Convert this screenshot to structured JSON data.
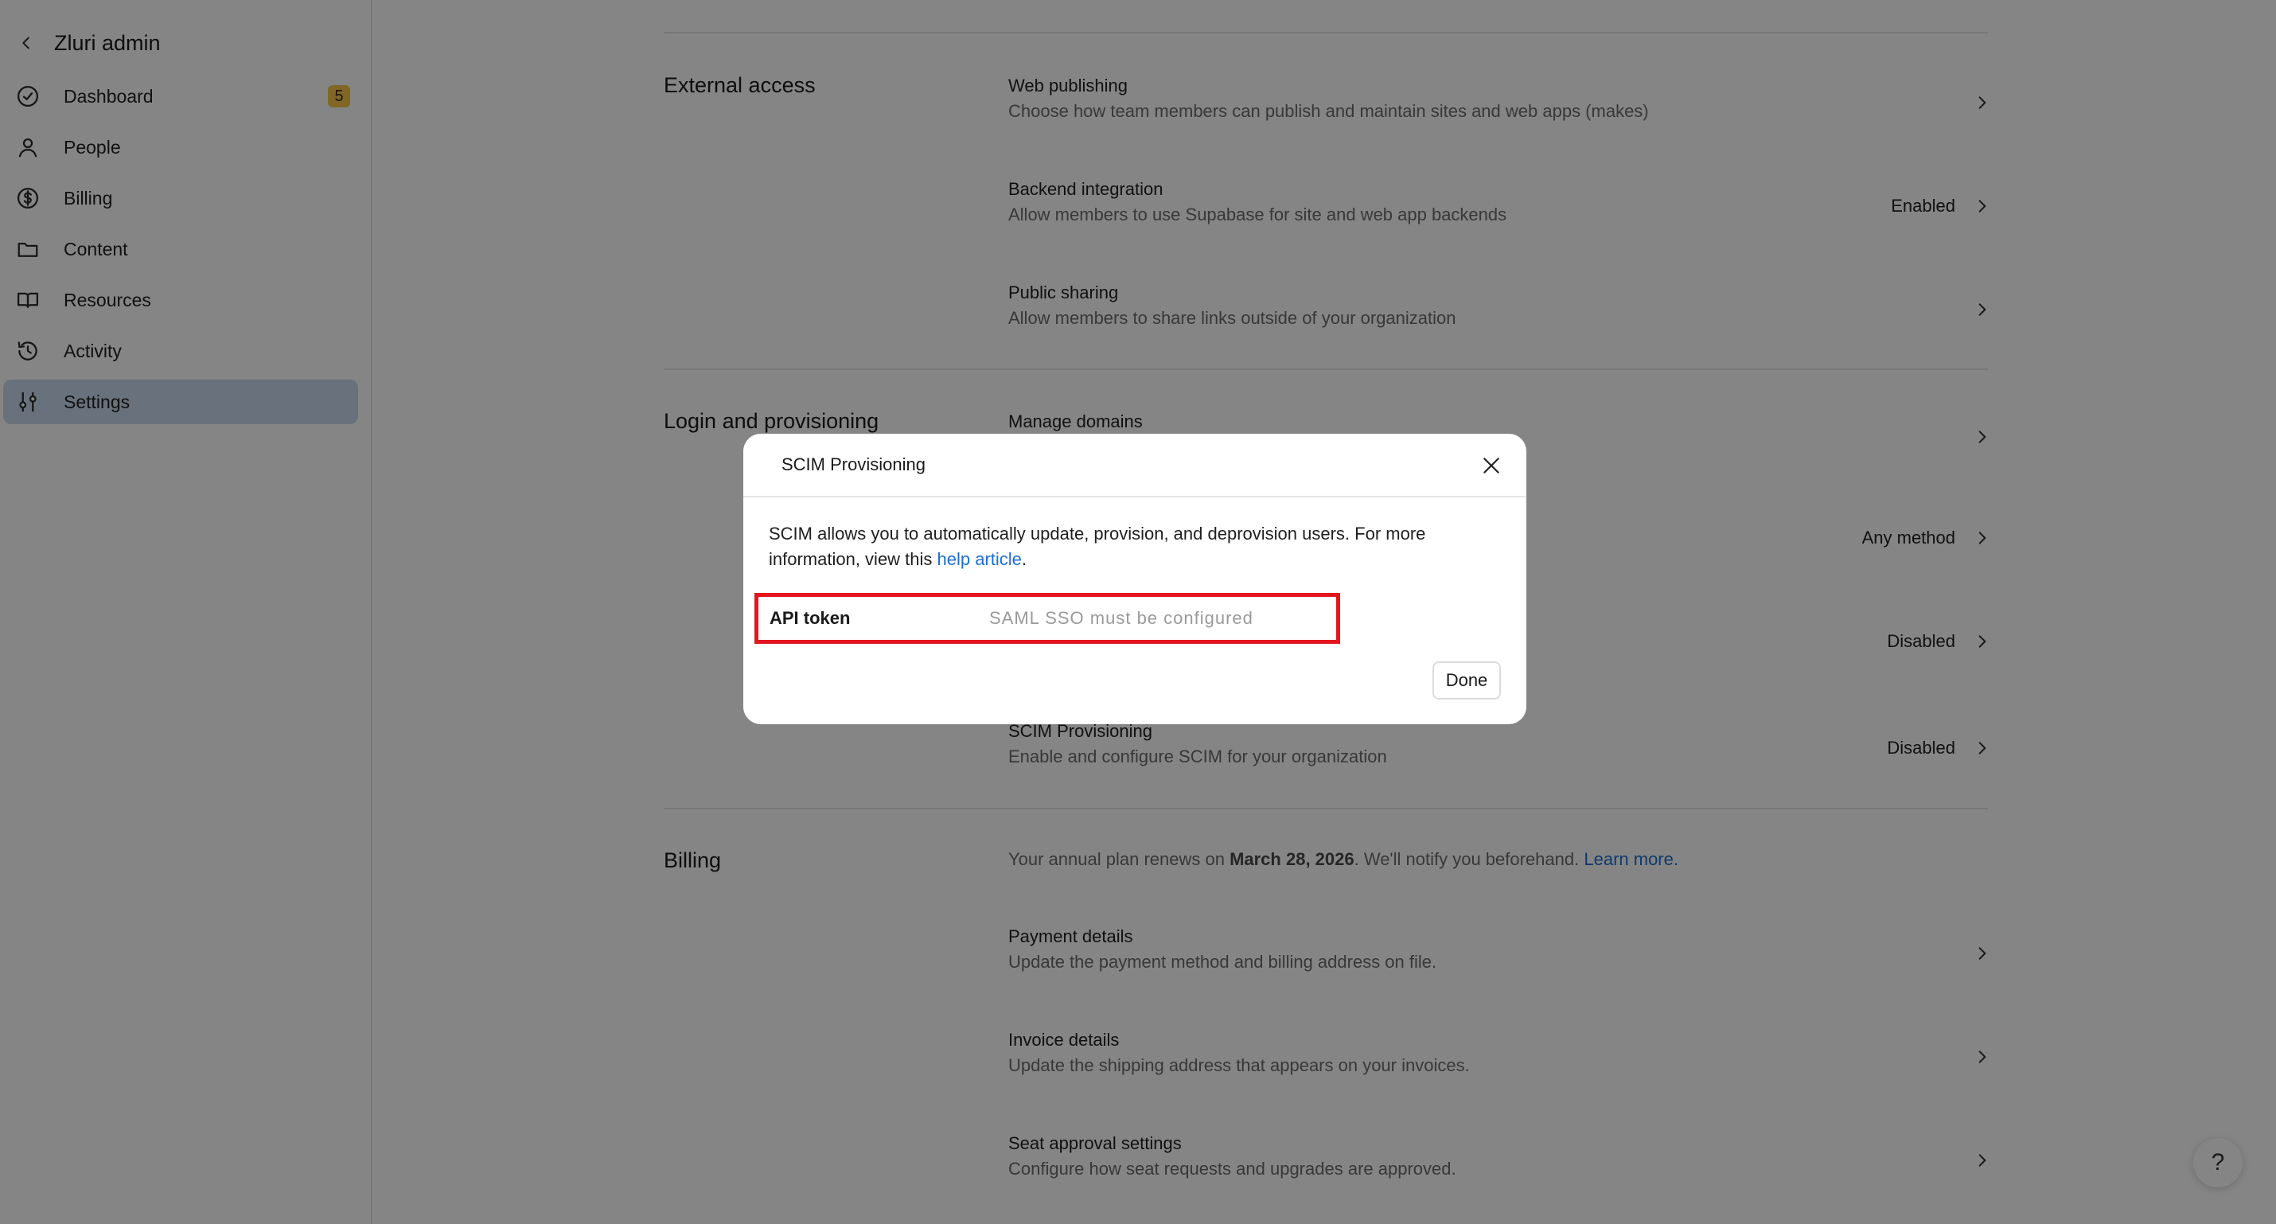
{
  "sidebar": {
    "title": "Zluri admin",
    "items": [
      {
        "label": "Dashboard",
        "icon": "check-circle-icon",
        "badge": "5"
      },
      {
        "label": "People",
        "icon": "person-icon"
      },
      {
        "label": "Billing",
        "icon": "dollar-circle-icon"
      },
      {
        "label": "Content",
        "icon": "folder-icon"
      },
      {
        "label": "Resources",
        "icon": "book-icon"
      },
      {
        "label": "Activity",
        "icon": "history-icon"
      },
      {
        "label": "Settings",
        "icon": "sliders-icon",
        "active": true
      }
    ]
  },
  "sections": {
    "external_access": {
      "title": "External access",
      "rows": [
        {
          "title": "Web publishing",
          "desc": "Choose how team members can publish and maintain sites and web apps (makes)",
          "status": ""
        },
        {
          "title": "Backend integration",
          "desc": "Allow members to use Supabase for site and web app backends",
          "status": "Enabled"
        },
        {
          "title": "Public sharing",
          "desc": "Allow members to share links outside of your organization",
          "status": ""
        }
      ]
    },
    "login": {
      "title": "Login and provisioning",
      "rows": [
        {
          "title": "Manage domains",
          "desc": "",
          "status": ""
        },
        {
          "title": "",
          "desc": "",
          "status": "Any method"
        },
        {
          "title": "",
          "desc": "",
          "status": "Disabled"
        },
        {
          "title": "SCIM Provisioning",
          "desc": "Enable and configure SCIM for your organization",
          "status": "Disabled"
        }
      ]
    },
    "billing": {
      "title": "Billing",
      "note_prefix": "Your annual plan renews on ",
      "note_date": "March 28, 2026",
      "note_suffix": ". We'll notify you beforehand. ",
      "note_link": "Learn more.",
      "rows": [
        {
          "title": "Payment details",
          "desc": "Update the payment method and billing address on file."
        },
        {
          "title": "Invoice details",
          "desc": "Update the shipping address that appears on your invoices."
        },
        {
          "title": "Seat approval settings",
          "desc": "Configure how seat requests and upgrades are approved."
        }
      ]
    }
  },
  "help_button": "?",
  "modal": {
    "title": "SCIM Provisioning",
    "body_prefix": "SCIM allows you to automatically update, provision, and deprovision users. For more information, view this ",
    "body_link": "help article",
    "body_suffix": ".",
    "token_label": "API token",
    "token_value": "SAML SSO must be configured",
    "done_label": "Done"
  },
  "colors": {
    "accent": "#1e6fd0",
    "highlight_box": "#e3161f",
    "active_nav": "#c9d9ee",
    "badge": "#f6c64a"
  }
}
